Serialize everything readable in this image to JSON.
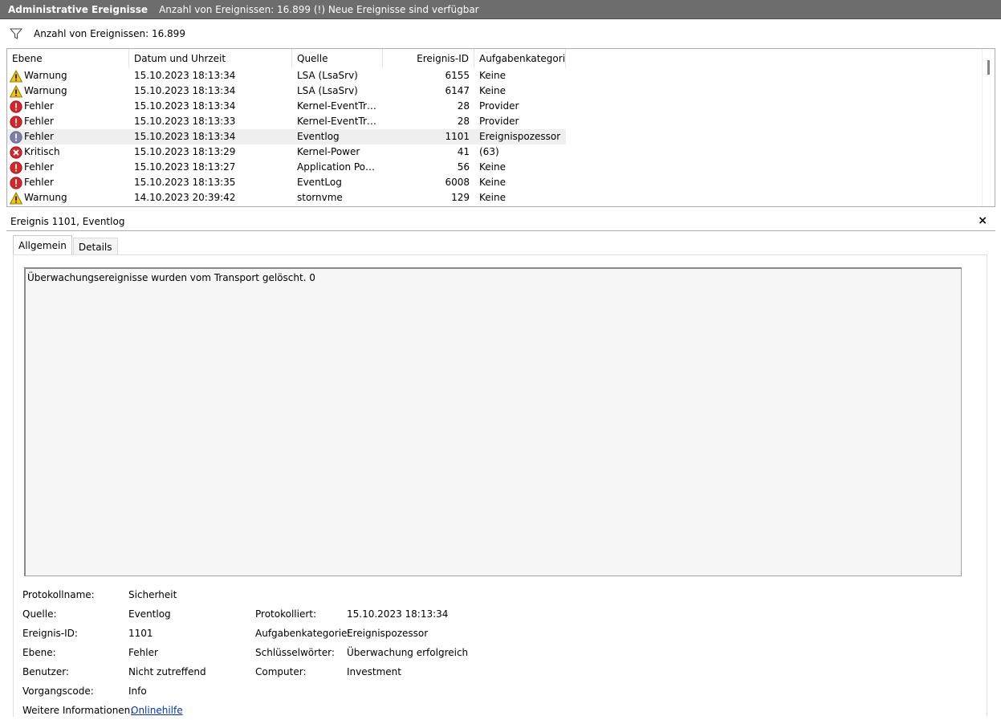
{
  "titlebar": {
    "title": "Administrative Ereignisse",
    "subtitle": "Anzahl von Ereignissen: 16.899 (!) Neue Ereignisse sind verfügbar"
  },
  "filterbar": {
    "icon": "filter-icon",
    "text": "Anzahl von Ereignissen: 16.899"
  },
  "list": {
    "columns": [
      "Ebene",
      "Datum und Uhrzeit",
      "Quelle",
      "Ereignis-ID",
      "Aufgabenkategorie"
    ],
    "rows": [
      {
        "level": "Warnung",
        "icon": "warning-icon",
        "datetime": "15.10.2023 18:13:34",
        "source": "LSA (LsaSrv)",
        "id": "6155",
        "category": "Keine"
      },
      {
        "level": "Warnung",
        "icon": "warning-icon",
        "datetime": "15.10.2023 18:13:34",
        "source": "LSA (LsaSrv)",
        "id": "6147",
        "category": "Keine"
      },
      {
        "level": "Fehler",
        "icon": "error-icon",
        "datetime": "15.10.2023 18:13:34",
        "source": "Kernel-EventTracing",
        "id": "28",
        "category": "Provider"
      },
      {
        "level": "Fehler",
        "icon": "error-icon",
        "datetime": "15.10.2023 18:13:33",
        "source": "Kernel-EventTracing",
        "id": "28",
        "category": "Provider"
      },
      {
        "level": "Fehler",
        "icon": "error-icon-dim",
        "datetime": "15.10.2023 18:13:34",
        "source": "Eventlog",
        "id": "1101",
        "category": "Ereignispozessor",
        "selected": true
      },
      {
        "level": "Kritisch",
        "icon": "critical-icon",
        "datetime": "15.10.2023 18:13:29",
        "source": "Kernel-Power",
        "id": "41",
        "category": "(63)"
      },
      {
        "level": "Fehler",
        "icon": "error-icon",
        "datetime": "15.10.2023 18:13:27",
        "source": "Application Popup",
        "id": "56",
        "category": "Keine"
      },
      {
        "level": "Fehler",
        "icon": "error-icon",
        "datetime": "15.10.2023 18:13:35",
        "source": "EventLog",
        "id": "6008",
        "category": "Keine"
      },
      {
        "level": "Warnung",
        "icon": "warning-icon",
        "datetime": "14.10.2023 20:39:42",
        "source": "stornvme",
        "id": "129",
        "category": "Keine"
      }
    ]
  },
  "detail": {
    "header": "Ereignis 1101, Eventlog",
    "close": "×",
    "tabs": [
      "Allgemein",
      "Details"
    ],
    "description": "Überwachungsereignisse wurden vom Transport gelöscht. 0",
    "props": {
      "protokollname_label": "Protokollname:",
      "protokollname": "Sicherheit",
      "quelle_label": "Quelle:",
      "quelle": "Eventlog",
      "protokolliert_label": "Protokolliert:",
      "protokolliert": "15.10.2023 18:13:34",
      "ereignisid_label": "Ereignis-ID:",
      "ereignisid": "1101",
      "aufgabenkategorie_label": "Aufgabenkategorie:",
      "aufgabenkategorie": "Ereignispozessor",
      "ebene_label": "Ebene:",
      "ebene": "Fehler",
      "schluesselwoerter_label": "Schlüsselwörter:",
      "schluesselwoerter": "Überwachung erfolgreich",
      "benutzer_label": "Benutzer:",
      "benutzer": "Nicht zutreffend",
      "computer_label": "Computer:",
      "computer": "Investment",
      "vorgangscode_label": "Vorgangscode:",
      "vorgangscode": "Info",
      "weitere_label": "Weitere Informationen:",
      "weitere_link": "Onlinehilfe"
    }
  }
}
